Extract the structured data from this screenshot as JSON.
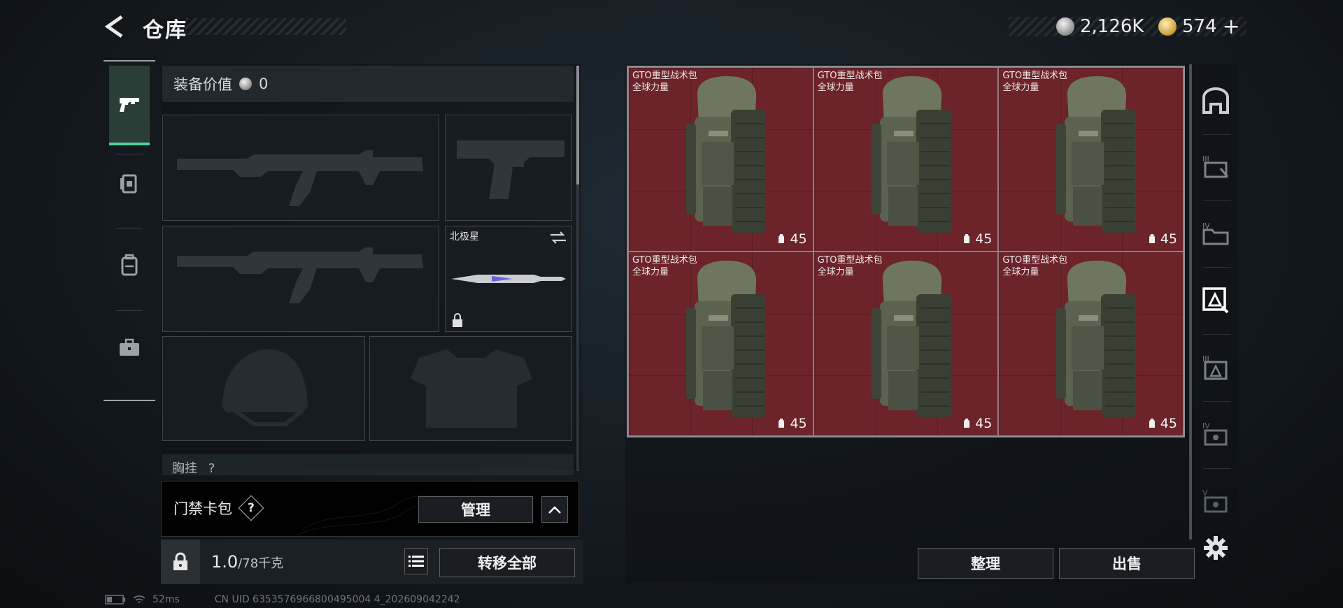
{
  "header": {
    "title": "仓库",
    "currencies": [
      {
        "icon": "silver-coin-icon",
        "value": "2,126K"
      },
      {
        "icon": "gold-coin-icon",
        "value": "574"
      }
    ],
    "add_symbol": "+"
  },
  "left_tabs": [
    {
      "icon": "pistol-icon",
      "active": true
    },
    {
      "icon": "card-pack-icon",
      "active": false
    },
    {
      "icon": "backpack-icon",
      "active": false
    },
    {
      "icon": "toolbox-icon",
      "active": false
    }
  ],
  "equipment": {
    "value_label": "装备价值",
    "value": "0",
    "secondary_slot": {
      "name": "北极星"
    },
    "chest_label": "胸挂",
    "chest_help": "?"
  },
  "keycard": {
    "label": "门禁卡包",
    "help": "?",
    "manage_label": "管理"
  },
  "capacity": {
    "current": "1.0",
    "max": "/78千克",
    "transfer_all_label": "转移全部"
  },
  "stash": {
    "items": [
      {
        "name": "GTO重型战术包",
        "subtitle": "全球力量",
        "count": "45"
      },
      {
        "name": "GTO重型战术包",
        "subtitle": "全球力量",
        "count": "45"
      },
      {
        "name": "GTO重型战术包",
        "subtitle": "全球力量",
        "count": "45"
      },
      {
        "name": "GTO重型战术包",
        "subtitle": "全球力量",
        "count": "45"
      },
      {
        "name": "GTO重型战术包",
        "subtitle": "全球力量",
        "count": "45"
      },
      {
        "name": "GTO重型战术包",
        "subtitle": "全球力量",
        "count": "45"
      }
    ],
    "sort_label": "整理",
    "sell_label": "出售"
  },
  "right_tabs": [
    {
      "icon": "vault-icon",
      "label": ""
    },
    {
      "icon": "tier-3-stash-icon",
      "label": "III"
    },
    {
      "icon": "tier-4-stash-icon",
      "label": "IV"
    },
    {
      "icon": "tier-stash-active-icon",
      "label": ""
    },
    {
      "icon": "tier-3-alt-stash-icon",
      "label": "III"
    },
    {
      "icon": "tier-4-alt-stash-icon",
      "label": "IV"
    },
    {
      "icon": "tier-5-stash-icon",
      "label": "V"
    }
  ],
  "status_bar": {
    "ping": "52ms",
    "uid": "CN UID 6353576966800495004 4_202609042242"
  },
  "colors": {
    "accent_green": "#4fd19a",
    "stash_red": "#6c2329"
  }
}
